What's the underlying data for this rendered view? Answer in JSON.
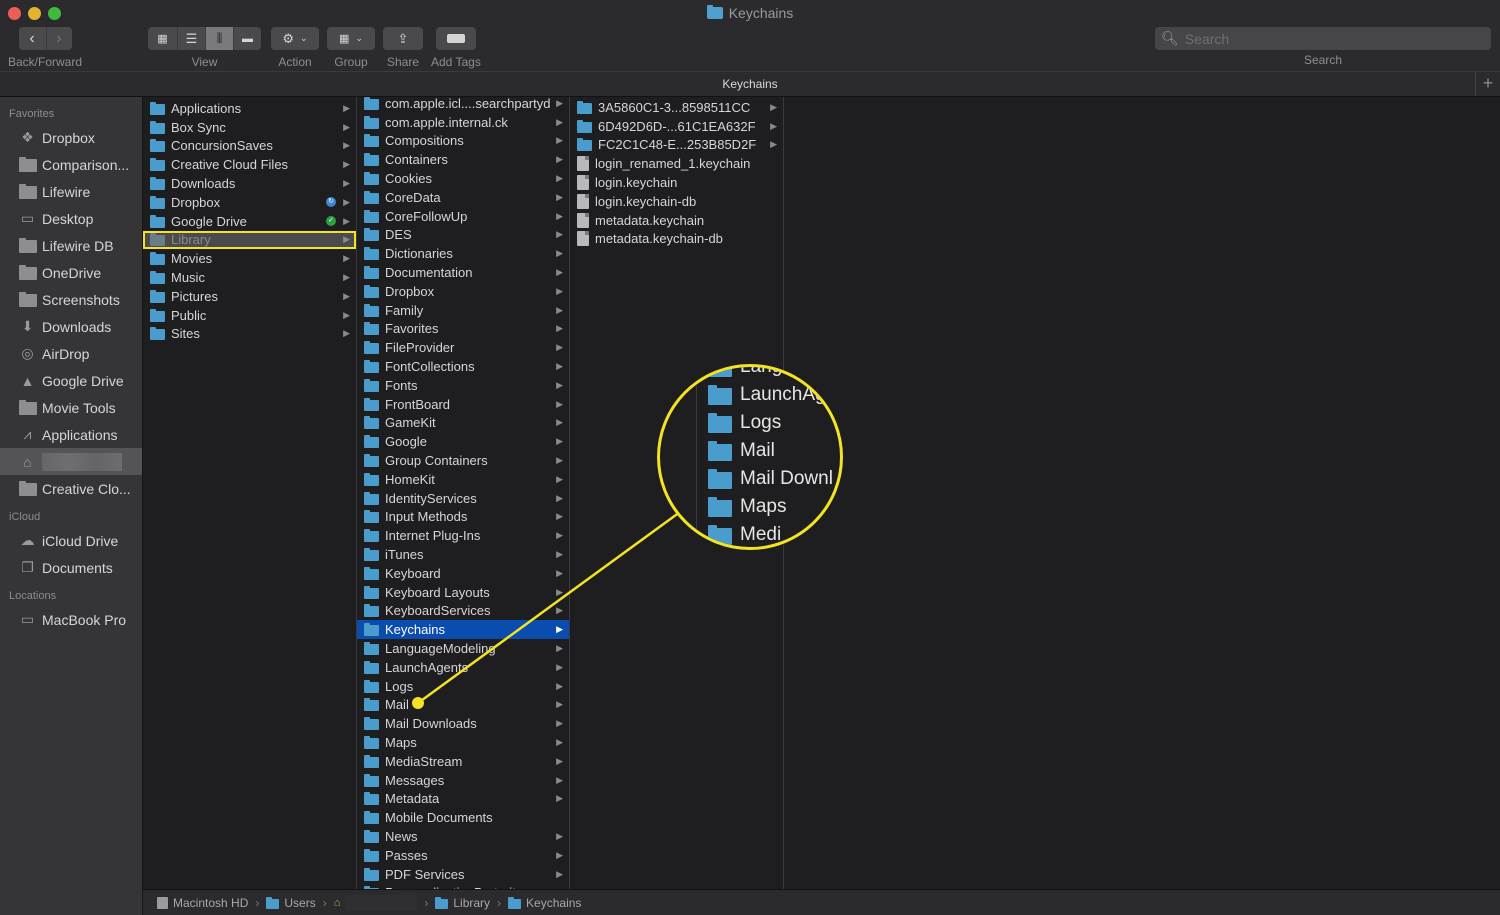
{
  "window": {
    "title": "Keychains",
    "controls": [
      "close",
      "minimize",
      "maximize"
    ]
  },
  "toolbar": {
    "back_forward_label": "Back/Forward",
    "view_label": "View",
    "action_label": "Action",
    "group_label": "Group",
    "share_label": "Share",
    "add_tags_label": "Add Tags",
    "view_modes": [
      "icon",
      "list",
      "column",
      "gallery"
    ],
    "active_view_mode": "column",
    "search_placeholder": "Search",
    "search_label": "Search"
  },
  "pathbar": {
    "title": "Keychains",
    "add_tab": "+"
  },
  "sidebar": {
    "favorites_heading": "Favorites",
    "favorites": [
      {
        "label": "Dropbox",
        "icon": "dropbox-icon"
      },
      {
        "label": "Comparison...",
        "icon": "folder-icon"
      },
      {
        "label": "Lifewire",
        "icon": "folder-icon"
      },
      {
        "label": "Desktop",
        "icon": "desktop-icon"
      },
      {
        "label": "Lifewire DB",
        "icon": "folder-icon"
      },
      {
        "label": "OneDrive",
        "icon": "folder-icon"
      },
      {
        "label": "Screenshots",
        "icon": "folder-icon"
      },
      {
        "label": "Downloads",
        "icon": "downloads-icon"
      },
      {
        "label": "AirDrop",
        "icon": "airdrop-icon"
      },
      {
        "label": "Google Drive",
        "icon": "google-drive-icon"
      },
      {
        "label": "Movie Tools",
        "icon": "folder-icon"
      },
      {
        "label": "Applications",
        "icon": "applications-icon"
      },
      {
        "label": "",
        "icon": "home-icon",
        "selected": true
      },
      {
        "label": "Creative Clo...",
        "icon": "folder-icon"
      }
    ],
    "icloud_heading": "iCloud",
    "icloud": [
      {
        "label": "iCloud Drive",
        "icon": "cloud-icon"
      },
      {
        "label": "Documents",
        "icon": "documents-icon"
      }
    ],
    "locations_heading": "Locations",
    "locations": [
      {
        "label": "MacBook Pro",
        "icon": "laptop-icon"
      }
    ]
  },
  "columns": {
    "home": [
      {
        "name": "Applications",
        "arrow": true
      },
      {
        "name": "Box Sync",
        "arrow": true
      },
      {
        "name": "ConcursionSaves",
        "arrow": true
      },
      {
        "name": "Creative Cloud Files",
        "arrow": true
      },
      {
        "name": "Downloads",
        "arrow": true
      },
      {
        "name": "Dropbox",
        "arrow": true,
        "badge": "sync"
      },
      {
        "name": "Google Drive",
        "arrow": true,
        "badge": "ok"
      },
      {
        "name": "Library",
        "arrow": true,
        "selected": true
      },
      {
        "name": "Movies",
        "arrow": true
      },
      {
        "name": "Music",
        "arrow": true
      },
      {
        "name": "Pictures",
        "arrow": true
      },
      {
        "name": "Public",
        "arrow": true
      },
      {
        "name": "Sites",
        "arrow": true
      }
    ],
    "library": [
      {
        "name": "com.apple.icl....searchpartyd",
        "arrow": true
      },
      {
        "name": "com.apple.internal.ck",
        "arrow": true
      },
      {
        "name": "Compositions",
        "arrow": true
      },
      {
        "name": "Containers",
        "arrow": true
      },
      {
        "name": "Cookies",
        "arrow": true
      },
      {
        "name": "CoreData",
        "arrow": true
      },
      {
        "name": "CoreFollowUp",
        "arrow": true
      },
      {
        "name": "DES",
        "arrow": true
      },
      {
        "name": "Dictionaries",
        "arrow": true
      },
      {
        "name": "Documentation",
        "arrow": true
      },
      {
        "name": "Dropbox",
        "arrow": true
      },
      {
        "name": "Family",
        "arrow": true
      },
      {
        "name": "Favorites",
        "arrow": true
      },
      {
        "name": "FileProvider",
        "arrow": true
      },
      {
        "name": "FontCollections",
        "arrow": true
      },
      {
        "name": "Fonts",
        "arrow": true
      },
      {
        "name": "FrontBoard",
        "arrow": true
      },
      {
        "name": "GameKit",
        "arrow": true
      },
      {
        "name": "Google",
        "arrow": true
      },
      {
        "name": "Group Containers",
        "arrow": true
      },
      {
        "name": "HomeKit",
        "arrow": true
      },
      {
        "name": "IdentityServices",
        "arrow": true
      },
      {
        "name": "Input Methods",
        "arrow": true
      },
      {
        "name": "Internet Plug-Ins",
        "arrow": true
      },
      {
        "name": "iTunes",
        "arrow": true
      },
      {
        "name": "Keyboard",
        "arrow": true
      },
      {
        "name": "Keyboard Layouts",
        "arrow": true
      },
      {
        "name": "KeyboardServices",
        "arrow": true
      },
      {
        "name": "Keychains",
        "arrow": true,
        "selected": true
      },
      {
        "name": "LanguageModeling",
        "arrow": true
      },
      {
        "name": "LaunchAgents",
        "arrow": true
      },
      {
        "name": "Logs",
        "arrow": true
      },
      {
        "name": "Mail",
        "arrow": true
      },
      {
        "name": "Mail Downloads",
        "arrow": true
      },
      {
        "name": "Maps",
        "arrow": true
      },
      {
        "name": "MediaStream",
        "arrow": true
      },
      {
        "name": "Messages",
        "arrow": true
      },
      {
        "name": "Metadata",
        "arrow": true
      },
      {
        "name": "Mobile Documents",
        "arrow": false
      },
      {
        "name": "News",
        "arrow": true
      },
      {
        "name": "Passes",
        "arrow": true
      },
      {
        "name": "PDF Services",
        "arrow": true
      },
      {
        "name": "PersonalizationPortrait",
        "arrow": true
      }
    ],
    "keychains": [
      {
        "name": "3A5860C1-3...8598511CC",
        "type": "folder",
        "arrow": true
      },
      {
        "name": "6D492D6D-...61C1EA632F",
        "type": "folder",
        "arrow": true
      },
      {
        "name": "FC2C1C48-E...253B85D2F",
        "type": "folder",
        "arrow": true
      },
      {
        "name": "login_renamed_1.keychain",
        "type": "file",
        "arrow": false
      },
      {
        "name": "login.keychain",
        "type": "file",
        "arrow": false
      },
      {
        "name": "login.keychain-db",
        "type": "file",
        "arrow": false
      },
      {
        "name": "metadata.keychain",
        "type": "file",
        "arrow": false
      },
      {
        "name": "metadata.keychain-db",
        "type": "file",
        "arrow": false
      }
    ]
  },
  "statusbar": {
    "crumbs": [
      "Macintosh HD",
      "Users",
      "",
      "Library",
      "Keychains"
    ]
  },
  "annotation": {
    "color": "#f4e224",
    "magnified_items": [
      "Langu",
      "LaunchAg",
      "Logs",
      "Mail",
      "Mail Downl",
      "Maps",
      "Medi"
    ],
    "target_item": "Mail"
  },
  "colors": {
    "selection_blue": "#0b4dae",
    "folder_blue": "#4a9ccd",
    "highlight_yellow": "#f4e224"
  }
}
